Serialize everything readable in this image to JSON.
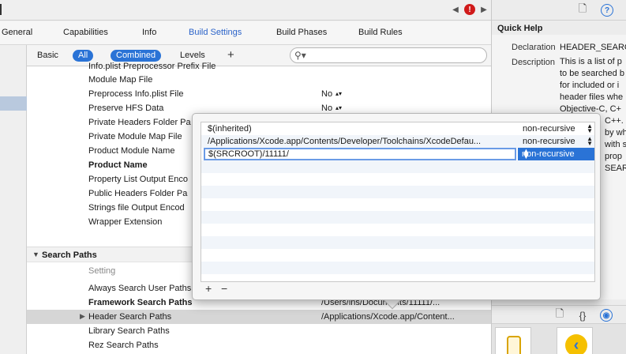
{
  "toolbar": {
    "nav_prev": "◀",
    "nav_next": "▶",
    "alert_count": "!"
  },
  "tabs": [
    {
      "label": "General"
    },
    {
      "label": "Capabilities"
    },
    {
      "label": "Info"
    },
    {
      "label": "Build Settings",
      "active": true
    },
    {
      "label": "Build Phases"
    },
    {
      "label": "Build Rules"
    }
  ],
  "filter": {
    "basic": "Basic",
    "all": "All",
    "combined": "Combined",
    "levels": "Levels",
    "add": "+",
    "search_placeholder": ""
  },
  "settings": [
    {
      "name": "Info.plist Preprocessor Prefix File",
      "value": ""
    },
    {
      "name": "Module Map File",
      "value": ""
    },
    {
      "name": "Preprocess Info.plist File",
      "value": "No"
    },
    {
      "name": "Preserve HFS Data",
      "value": "No"
    },
    {
      "name": "Private Headers Folder Pa",
      "value": ""
    },
    {
      "name": "Private Module Map File",
      "value": ""
    },
    {
      "name": "Product Module Name",
      "value": ""
    },
    {
      "name": "Product Name",
      "value": "",
      "bold": true
    },
    {
      "name": "Property List Output Enco",
      "value": ""
    },
    {
      "name": "Public Headers Folder Pa",
      "value": ""
    },
    {
      "name": "Strings file Output Encod",
      "value": ""
    },
    {
      "name": "Wrapper Extension",
      "value": ""
    }
  ],
  "search_paths": {
    "section_title": "Search Paths",
    "column_header": "Setting",
    "rows": [
      {
        "name": "Always Search User Paths",
        "value": ""
      },
      {
        "name": "Framework Search Paths",
        "value": "/Users/lns/Documents/11111/...",
        "bold": true
      },
      {
        "name": "Header Search Paths",
        "value": "/Applications/Xcode.app/Content...",
        "selected": true
      },
      {
        "name": "Library Search Paths",
        "value": ""
      },
      {
        "name": "Rez Search Paths",
        "value": ""
      }
    ]
  },
  "popover": {
    "entries": [
      {
        "path": "$(inherited)",
        "recursion": "non-recursive"
      },
      {
        "path": "/Applications/Xcode.app/Contents/Developer/Toolchains/XcodeDefau...",
        "recursion": "non-recursive"
      },
      {
        "path": "$(SRCROOT)/11111/",
        "recursion": "non-recursive",
        "editing": true
      }
    ],
    "add_button": "+",
    "remove_button": "−"
  },
  "quick_help": {
    "title": "Quick Help",
    "declaration_label": "Declaration",
    "declaration_value": "HEADER_SEARCH",
    "description_label": "Description",
    "description_lines": [
      "This is a list of p",
      "to be searched b",
      "for included or i",
      "header files whe",
      "Objective-C, C+",
      "C++.",
      "by wh",
      "with s",
      "prop",
      "SEARC"
    ]
  },
  "colors": {
    "accent": "#2a73d6",
    "alert": "#d01a1a",
    "selection": "#d6d6d6"
  }
}
